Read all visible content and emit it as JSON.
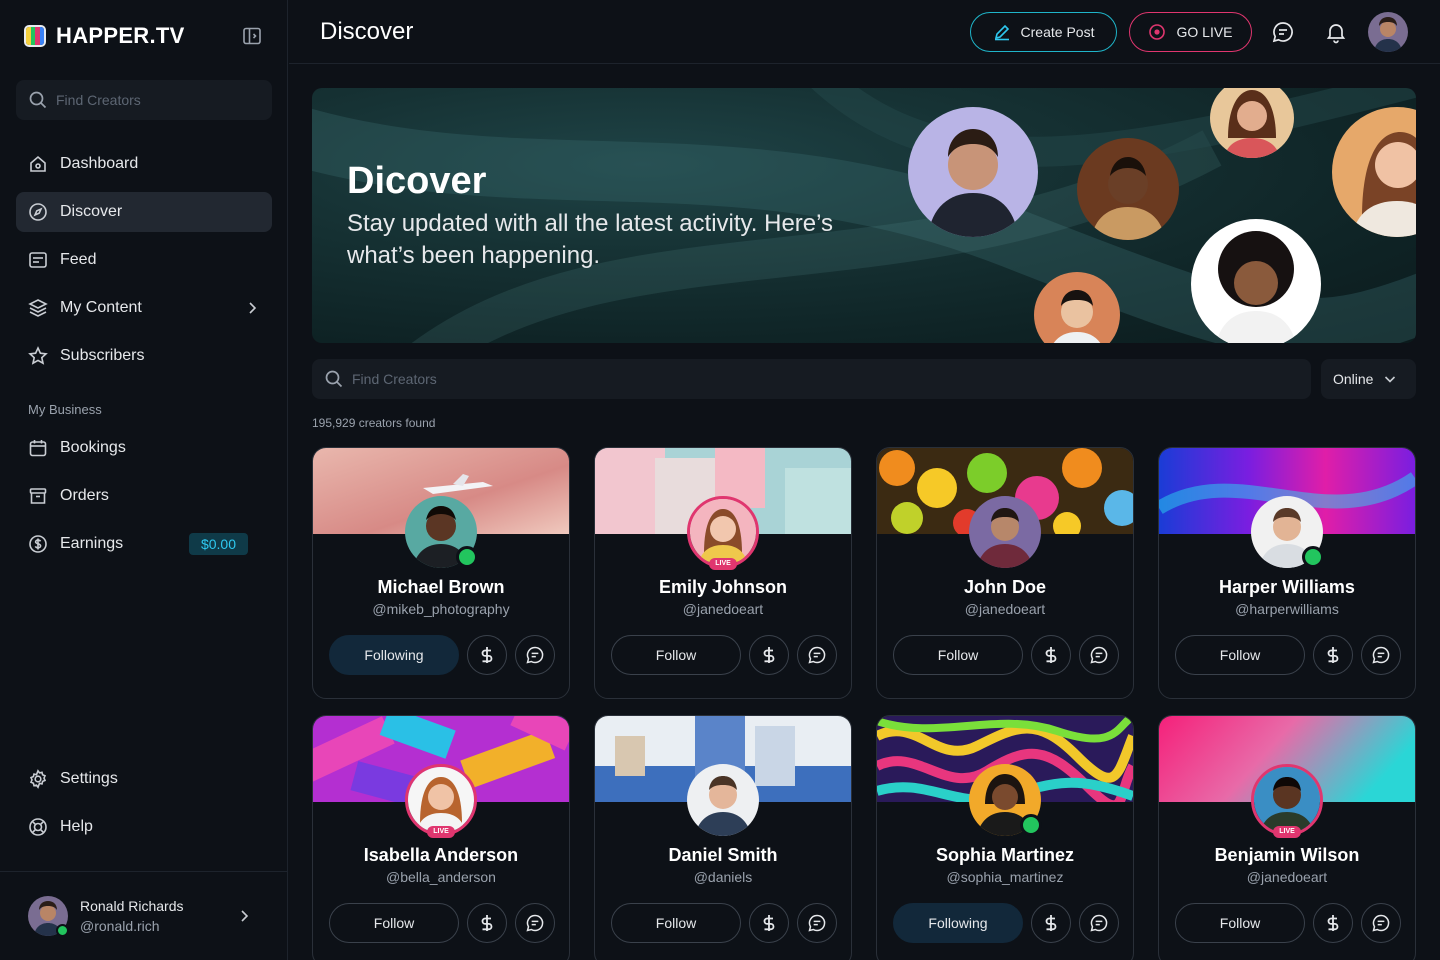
{
  "brand": {
    "name": "HAPPER.TV"
  },
  "sidebar": {
    "search_placeholder": "Find Creators",
    "items": [
      {
        "label": "Dashboard",
        "icon": "home-icon"
      },
      {
        "label": "Discover",
        "icon": "compass-icon",
        "active": true
      },
      {
        "label": "Feed",
        "icon": "feed-icon"
      },
      {
        "label": "My Content",
        "icon": "layers-icon"
      },
      {
        "label": "Subscribers",
        "icon": "star-icon"
      }
    ],
    "section_label": "My Business",
    "business_items": [
      {
        "label": "Bookings",
        "icon": "calendar-icon"
      },
      {
        "label": "Orders",
        "icon": "box-icon"
      },
      {
        "label": "Earnings",
        "icon": "dollar-circle-icon",
        "badge": "$0.00"
      }
    ],
    "bottom_items": [
      {
        "label": "Settings",
        "icon": "gear-icon"
      },
      {
        "label": "Help",
        "icon": "lifebuoy-icon"
      }
    ],
    "user": {
      "name": "Ronald Richards",
      "handle": "@ronald.rich"
    }
  },
  "header": {
    "title": "Discover",
    "create_label": "Create Post",
    "live_label": "GO LIVE"
  },
  "hero": {
    "title": "Dicover",
    "subtitle": "Stay updated with all the latest activity. Here’s what’s been happening."
  },
  "search": {
    "placeholder": "Find Creators",
    "filter_value": "Online",
    "result_count": "195,929 creators found"
  },
  "colors": {
    "accent_teal": "#1fb5c9",
    "accent_pink": "#e0366f",
    "online_green": "#22c55e",
    "background": "#0d1117"
  },
  "creators": [
    {
      "name": "Michael Brown",
      "handle": "@mikeb_photography",
      "action": "Following",
      "status": "online"
    },
    {
      "name": "Emily Johnson",
      "handle": "@janedoeart",
      "action": "Follow",
      "status": "live",
      "live_label": "LIVE"
    },
    {
      "name": "John Doe",
      "handle": "@janedoeart",
      "action": "Follow",
      "status": "none"
    },
    {
      "name": "Harper Williams",
      "handle": "@harperwilliams",
      "action": "Follow",
      "status": "online"
    },
    {
      "name": "Isabella Anderson",
      "handle": "@bella_anderson",
      "action": "Follow",
      "status": "live",
      "live_label": "LIVE"
    },
    {
      "name": "Daniel Smith",
      "handle": "@daniels",
      "action": "Follow",
      "status": "none"
    },
    {
      "name": "Sophia Martinez",
      "handle": "@sophia_martinez",
      "action": "Following",
      "status": "online"
    },
    {
      "name": "Benjamin Wilson",
      "handle": "@janedoeart",
      "action": "Follow",
      "status": "live",
      "live_label": "LIVE"
    }
  ]
}
